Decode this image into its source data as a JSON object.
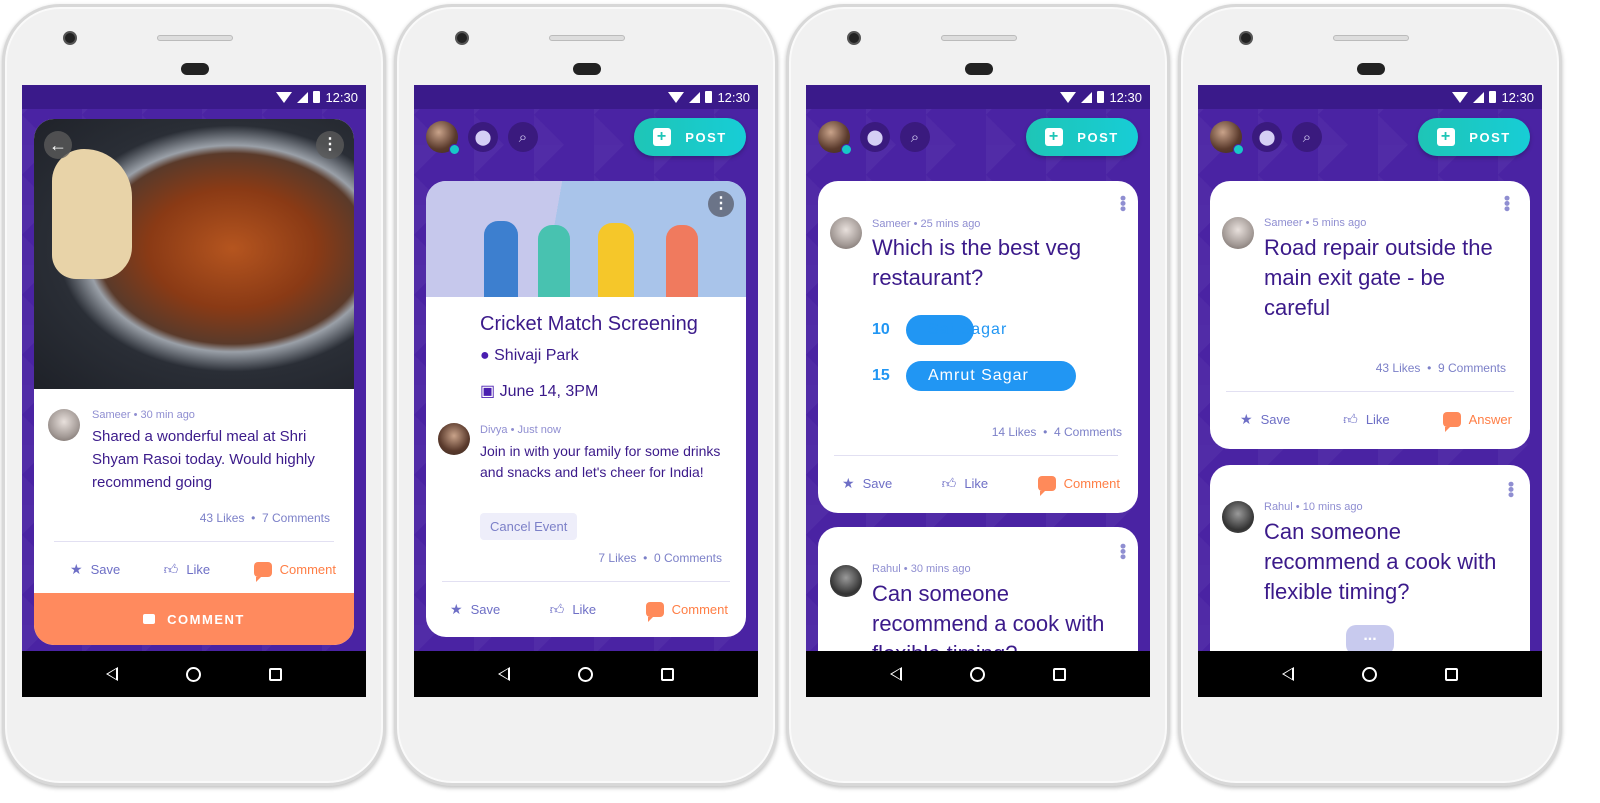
{
  "status": {
    "time": "12:30"
  },
  "phone1": {
    "post": {
      "author": "Sameer",
      "time": "30 min ago",
      "text": "Shared a wonderful meal at Shri Shyam Rasoi today. Would highly recommend going",
      "likes": "43 Likes",
      "comments": "7 Comments"
    },
    "actions": {
      "save": "Save",
      "like": "Like",
      "comment": "Comment"
    },
    "cta": "COMMENT"
  },
  "phone2": {
    "topbar": {
      "post_label": "POST"
    },
    "event": {
      "title": "Cricket Match Screening",
      "location": "Shivaji Park",
      "date": "June 14, 3PM"
    },
    "post": {
      "author": "Divya",
      "time": "Just now",
      "text": "Join in with your family for some drinks and snacks and let's cheer for India!",
      "cancel": "Cancel Event",
      "likes": "7 Likes",
      "comments": "0 Comments"
    },
    "actions": {
      "save": "Save",
      "like": "Like",
      "comment": "Comment"
    }
  },
  "phone3": {
    "topbar": {
      "post_label": "POST"
    },
    "poll": {
      "author": "Sameer",
      "time": "25 mins ago",
      "question": "Which is the best veg restaurant?",
      "options": [
        {
          "count": "10",
          "label": "Sai Sagar",
          "share": 0.4
        },
        {
          "count": "15",
          "label": "Amrut Sagar",
          "share": 1.0
        }
      ],
      "likes": "14 Likes",
      "comments": "4 Comments"
    },
    "actions": {
      "save": "Save",
      "like": "Like",
      "comment": "Comment"
    },
    "next": {
      "author": "Rahul",
      "time": "30 mins ago",
      "text": "Can someone recommend a cook with flexible timing?"
    }
  },
  "phone4": {
    "topbar": {
      "post_label": "POST"
    },
    "post": {
      "author": "Sameer",
      "time": "5 mins ago",
      "text": "Road repair outside the main exit gate - be careful",
      "likes": "43 Likes",
      "comments": "9 Comments"
    },
    "actions": {
      "save": "Save",
      "like": "Like",
      "answer": "Answer"
    },
    "next": {
      "author": "Rahul",
      "time": "10 mins ago",
      "text": "Can someone recommend a cook with flexible timing?"
    },
    "more": "..."
  }
}
